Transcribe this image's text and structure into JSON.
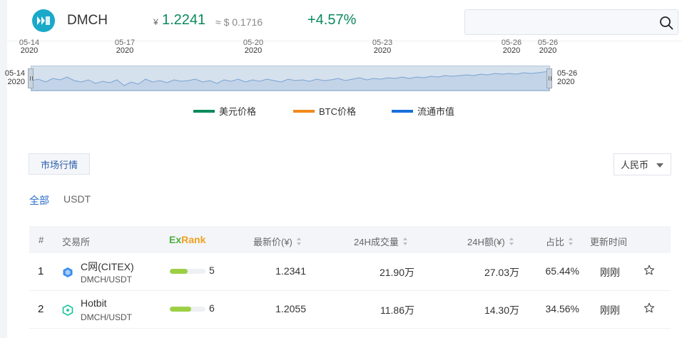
{
  "header": {
    "coin": "DMCH",
    "cny_symbol": "¥",
    "price_cny": "1.2241",
    "price_usd_approx": "≈ $ 0.1716",
    "change": "+4.57%",
    "search": {
      "placeholder": "",
      "value": ""
    }
  },
  "chart_navigator": {
    "top_dates": [
      {
        "date": "05-14",
        "year": "2020"
      },
      {
        "date": "05-17",
        "year": "2020"
      },
      {
        "date": "05-20",
        "year": "2020"
      },
      {
        "date": "05-23",
        "year": "2020"
      },
      {
        "date": "05-26",
        "year": "2020"
      },
      {
        "date": "05-26",
        "year": "2020"
      }
    ],
    "start": {
      "date": "05-14",
      "year": "2020"
    },
    "end": {
      "date": "05-26",
      "year": "2020"
    },
    "legend": [
      {
        "label": "美元价格",
        "color": "#0a8a5c"
      },
      {
        "label": "BTC价格",
        "color": "#f08a1c"
      },
      {
        "label": "流通市值",
        "color": "#1a6fdc"
      }
    ]
  },
  "market": {
    "tab_label": "市场行情",
    "currency_selected": "人民币",
    "filters": [
      "全部",
      "USDT"
    ],
    "columns": {
      "index": "#",
      "exchange": "交易所",
      "exrank_ex": "Ex",
      "exrank_rank": "Rank",
      "last_price": "最新价(¥)",
      "volume_24h": "24H成交量",
      "amount_24h": "24H额(¥)",
      "share": "占比",
      "updated": "更新时间"
    },
    "rows": [
      {
        "index": "1",
        "exchange": "C网(CITEX)",
        "pair": "DMCH/USDT",
        "exrank": "5",
        "exrank_fill": 0.5,
        "last_price": "1.2341",
        "volume": "21.90万",
        "amount": "27.03万",
        "share": "65.44%",
        "updated": "刚刚",
        "icon_color": "#3b8ef0"
      },
      {
        "index": "2",
        "exchange": "Hotbit",
        "pair": "DMCH/USDT",
        "exrank": "6",
        "exrank_fill": 0.6,
        "last_price": "1.2055",
        "volume": "11.86万",
        "amount": "14.30万",
        "share": "34.56%",
        "updated": "刚刚",
        "icon_color": "#19c3a0"
      }
    ]
  },
  "icons": {
    "logo": "dmch-logo-icon",
    "search": "search-icon",
    "star": "star-outline-icon",
    "sort": "sort-arrows-icon",
    "caret": "caret-down-icon"
  }
}
